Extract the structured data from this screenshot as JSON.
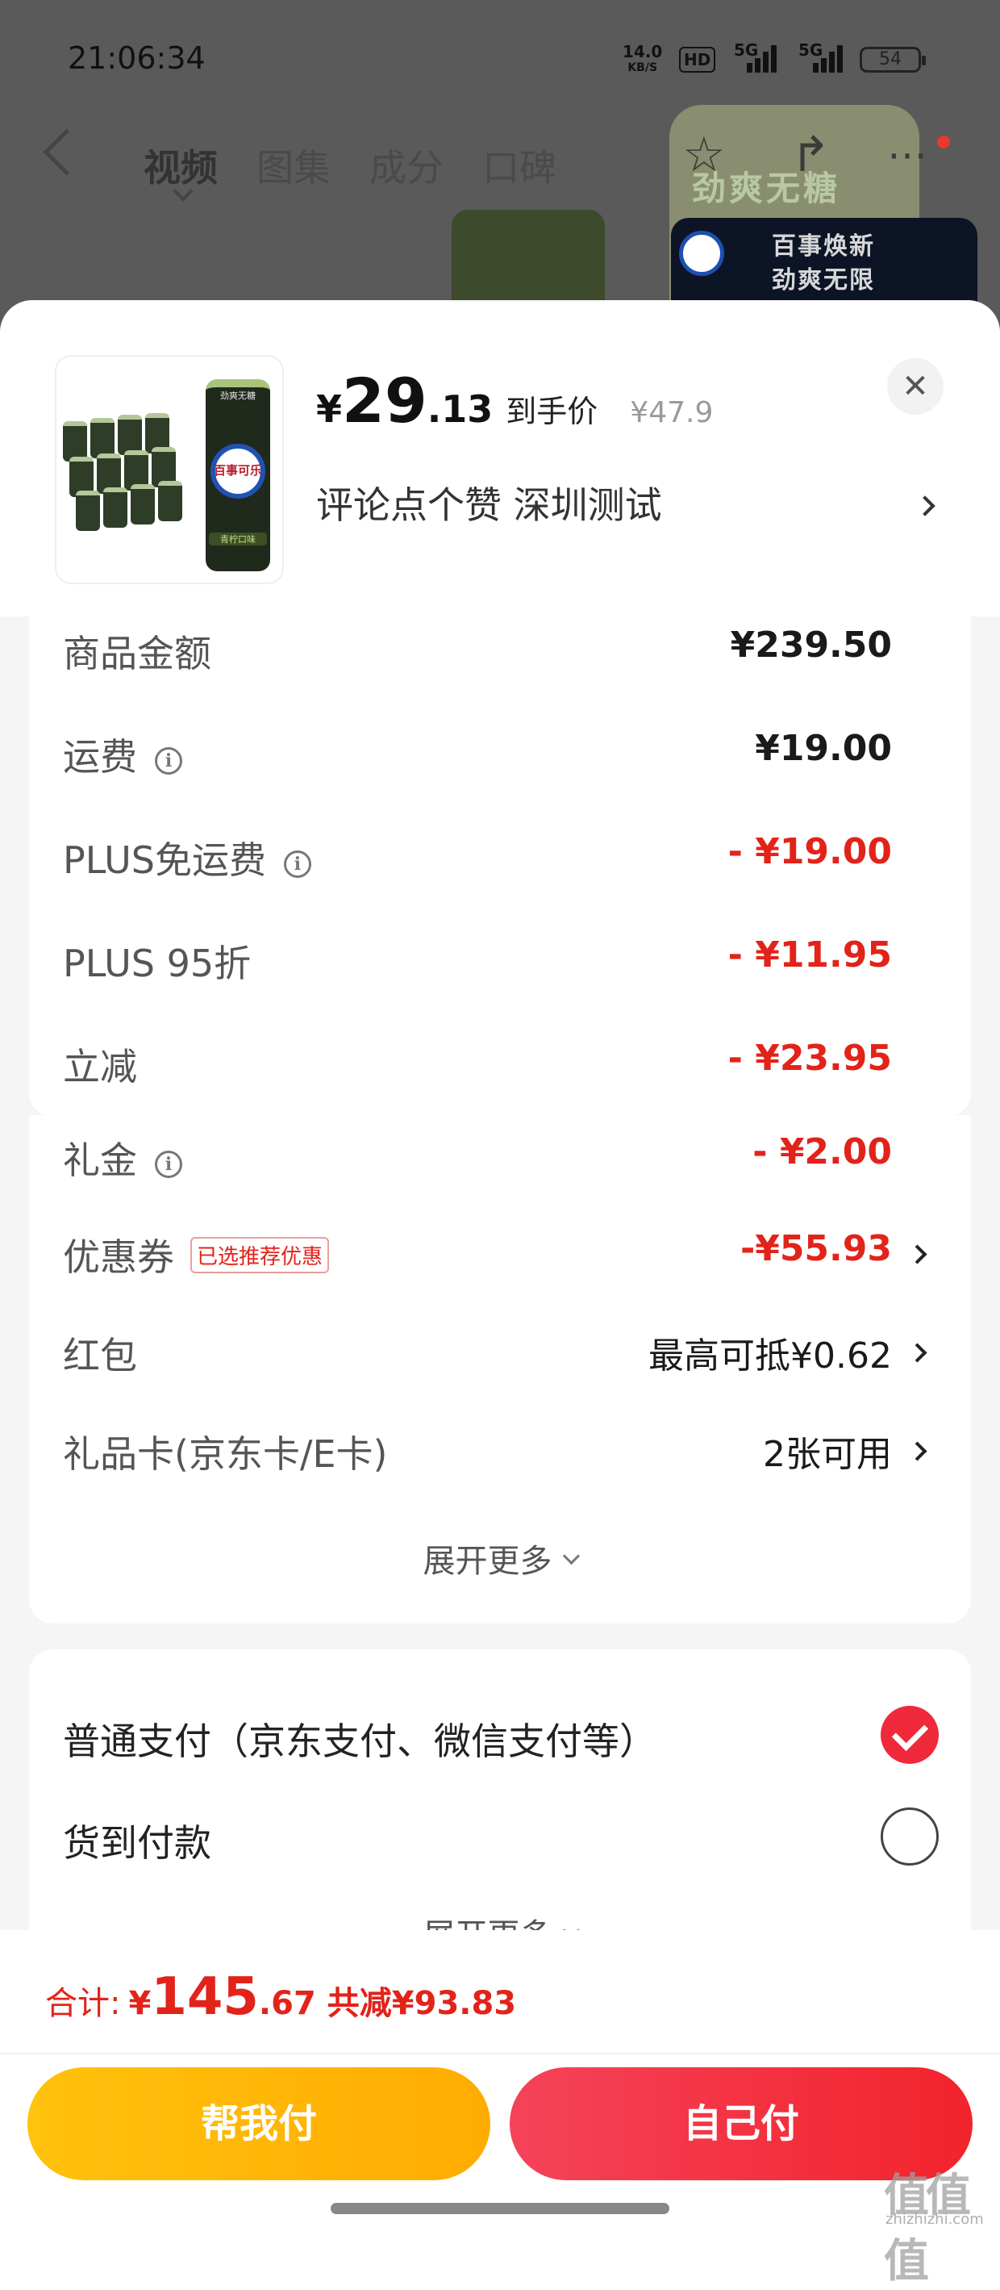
{
  "status_bar": {
    "time": "21:06:34",
    "net_speed_value": "14.0",
    "net_speed_unit": "KB/S",
    "hd": "HD",
    "signal1": "5G",
    "signal2": "5G",
    "battery": "54"
  },
  "product_page": {
    "tabs": [
      "视频",
      "图集",
      "成分",
      "口碑"
    ],
    "active_tab": "视频",
    "banner_brand": "劲爽无糖",
    "badge_line1": "百事焕新",
    "badge_line2": "劲爽无限"
  },
  "sheet": {
    "product_image": {
      "can_top_text": "劲爽无糖",
      "can_logo_text": "百事可乐",
      "can_bottom_text": "青柠口味"
    },
    "price": {
      "currency": "¥",
      "integer": "29",
      "decimal": ".13",
      "label": "到手价",
      "original": "¥47.9"
    },
    "subtitle": "评论点个赞  深圳测试",
    "close_symbol": "✕"
  },
  "fees": [
    {
      "label": "商品金额",
      "value": "¥239.50",
      "info": false,
      "tag": "",
      "style": "dark",
      "chevron": false
    },
    {
      "label": "运费",
      "value": "¥19.00",
      "info": true,
      "tag": "",
      "style": "dark",
      "chevron": false
    },
    {
      "label": "PLUS免运费",
      "value": "- ¥19.00",
      "info": true,
      "tag": "",
      "style": "red",
      "chevron": false
    },
    {
      "label": "PLUS 95折",
      "value": "- ¥11.95",
      "info": false,
      "tag": "",
      "style": "red",
      "chevron": false
    },
    {
      "label": "立减",
      "value": "- ¥23.95",
      "info": false,
      "tag": "",
      "style": "red",
      "chevron": false
    },
    {
      "label": "礼金",
      "value": "- ¥2.00",
      "info": true,
      "tag": "",
      "style": "red",
      "chevron": false
    },
    {
      "label": "优惠券",
      "value": "-¥55.93",
      "info": false,
      "tag": "已选推荐优惠",
      "style": "red",
      "chevron": true
    },
    {
      "label": "红包",
      "value": "最高可抵¥0.62",
      "info": false,
      "tag": "",
      "style": "dark",
      "chevron": true
    },
    {
      "label": "礼品卡(京东卡/E卡)",
      "value": "2张可用",
      "info": false,
      "tag": "",
      "style": "dark",
      "chevron": true
    }
  ],
  "fees_more": "展开更多",
  "payment": {
    "options": [
      {
        "label": "普通支付（京东支付、微信支付等）",
        "selected": true
      },
      {
        "label": "货到付款",
        "selected": false
      }
    ],
    "more": "展开更多"
  },
  "footer": {
    "total_label": "合计:",
    "currency": "¥",
    "total_integer": "145",
    "total_decimal": ".67",
    "savings": "共减¥93.83",
    "help_pay": "帮我付",
    "self_pay": "自己付"
  },
  "watermark": {
    "main": "值值值",
    "sub": "zhizhizhi.com"
  },
  "colors": {
    "accent_red": "#e2231a",
    "help_btn": "#ffb300",
    "self_btn": "#f2232b"
  }
}
